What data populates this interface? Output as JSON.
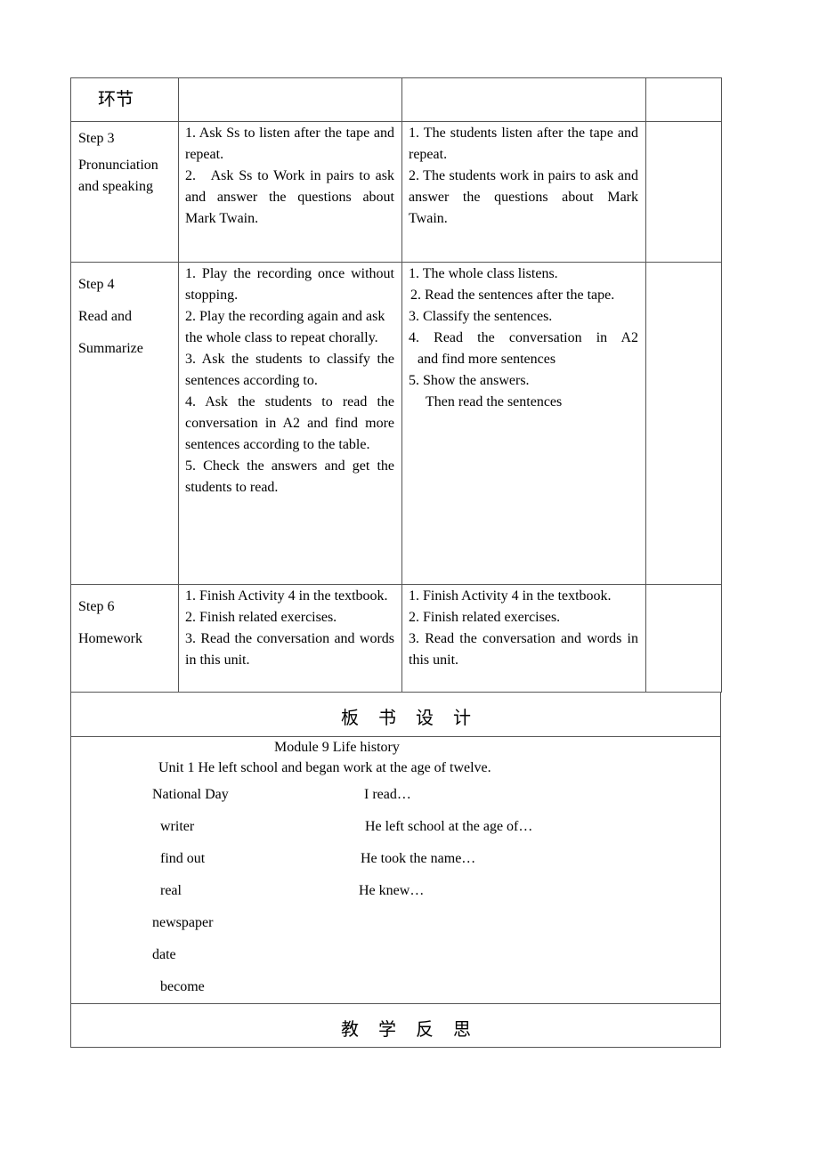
{
  "table": {
    "header": {
      "col1": "环节",
      "col2": "",
      "col3": "",
      "col4": ""
    },
    "rows": [
      {
        "step": [
          "Step 3",
          "Pronunciation",
          "and speaking"
        ],
        "teacher": [
          "1. Ask Ss to listen after the tape and repeat.",
          "2.   Ask Ss to Work in pairs to ask and answer the questions about Mark Twain."
        ],
        "students": [
          "1. The students listen after the tape and repeat.",
          "2. The students work in pairs to ask and answer the questions about Mark Twain."
        ]
      },
      {
        "step": [
          "Step 4",
          "Read and",
          "Summarize"
        ],
        "teacher": [
          "1. Play the recording once without stopping.",
          "2. Play the recording again and ask the whole class to repeat chorally.",
          "3. Ask the students to classify the sentences according to.",
          "4. Ask the students to read the conversation in A2 and find more sentences according to the table.",
          "5. Check the answers and get the students to read."
        ],
        "students": [
          "1. The whole class listens.",
          "2. Read the sentences after the tape.",
          "3. Classify the sentences.",
          "4. Read the conversation in A2",
          "and find more sentences",
          "5. Show the answers.",
          "Then read the sentences"
        ]
      },
      {
        "step": [
          "Step 6",
          "Homework"
        ],
        "teacher": [
          "1. Finish Activity 4 in the textbook.",
          "2. Finish related exercises.",
          "3. Read the conversation and words in this unit."
        ],
        "students": [
          "1. Finish Activity 4 in the textbook.",
          "2. Finish related exercises.",
          "3. Read the conversation and words in this unit."
        ]
      }
    ]
  },
  "board_design": {
    "heading": "板书设计",
    "module": "Module 9 Life history",
    "unit": "Unit 1 He left school and began work at the age of twelve.",
    "words": [
      "National Day",
      "writer",
      "find out",
      "real",
      "newspaper",
      "date",
      "become"
    ],
    "sentences": [
      "I read…",
      "He left school at the age of…",
      "He took the name…",
      "He knew…"
    ]
  },
  "reflection": {
    "heading": "教学反思"
  }
}
